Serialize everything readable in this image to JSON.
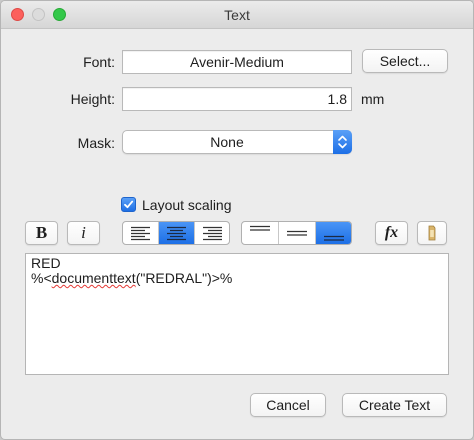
{
  "window": {
    "title": "Text"
  },
  "font": {
    "label": "Font:",
    "value": "Avenir-Medium",
    "select_button": "Select..."
  },
  "height": {
    "label": "Height:",
    "value": "1.8",
    "unit": "mm"
  },
  "mask": {
    "label": "Mask:",
    "value": "None"
  },
  "layout_scaling": {
    "label": "Layout scaling",
    "checked": true
  },
  "toolbar": {
    "bold": "B",
    "italic": "i",
    "function": "fx",
    "align_selected": "center",
    "valign_selected": "bottom"
  },
  "text": {
    "line1": "RED",
    "line2_prefix": "%<",
    "line2_misspelled": "documenttext",
    "line2_suffix": "(\"REDRAL\")>%"
  },
  "buttons": {
    "cancel": "Cancel",
    "create": "Create Text"
  },
  "colors": {
    "accent": "#1d6fe6",
    "close": "#fc605c",
    "maximize": "#34c84a"
  }
}
